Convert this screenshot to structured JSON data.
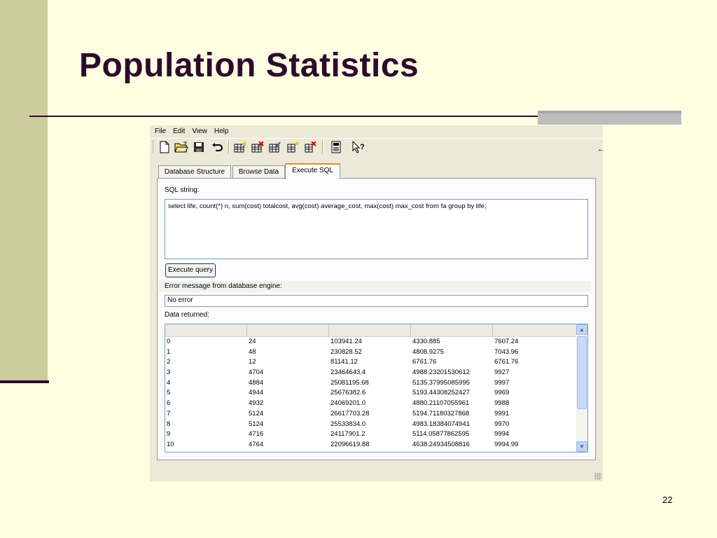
{
  "slide": {
    "title": "Population Statistics",
    "number": "22"
  },
  "app": {
    "menu": [
      "File",
      "Edit",
      "View",
      "Help"
    ],
    "toolbar_icons": [
      "new-file-icon",
      "open-folder-icon",
      "save-icon",
      "undo-icon",
      "create-table-icon",
      "delete-table-icon",
      "modify-table-icon",
      "create-index-icon",
      "delete-index-icon",
      "sql-log-icon",
      "whats-this-help-icon"
    ],
    "arrow_glyph": "←",
    "tabs": [
      "Database Structure",
      "Browse Data",
      "Execute SQL"
    ],
    "active_tab": "Execute SQL",
    "sql_label": "SQL string:",
    "sql_text": "select life,  count(*) n, sum(cost) totalcost, avg(cost) average_cost, max(cost) max_cost from fa group by life;",
    "execute_button": "Execute query",
    "error_label": "Error message from database engine:",
    "error_value": "No error",
    "data_label": "Data returned:",
    "table": {
      "rows": [
        [
          "0",
          "24",
          "103941.24",
          "4330.885",
          "7607.24"
        ],
        [
          "1",
          "48",
          "230828.52",
          "4808.9275",
          "7043.96"
        ],
        [
          "2",
          "12",
          "81141.12",
          "6761.76",
          "6761.76"
        ],
        [
          "3",
          "4704",
          "23464643.4",
          "4988.23201530612",
          "9927"
        ],
        [
          "4",
          "4884",
          "25081195.68",
          "5135.37995085995",
          "9997"
        ],
        [
          "5",
          "4944",
          "25676382.6",
          "5193.44308252427",
          "9969"
        ],
        [
          "6",
          "4932",
          "24069201.0",
          "4880.21107055961",
          "9988"
        ],
        [
          "7",
          "5124",
          "26617703.28",
          "5194.71180327868",
          "9991"
        ],
        [
          "8",
          "5124",
          "25533834.0",
          "4983.18384074941",
          "9970"
        ],
        [
          "9",
          "4716",
          "24117901.2",
          "5114.05877862595",
          "9994"
        ],
        [
          "10",
          "4764",
          "22096619.88",
          "4638.24934508816",
          "9994.99"
        ]
      ]
    }
  }
}
